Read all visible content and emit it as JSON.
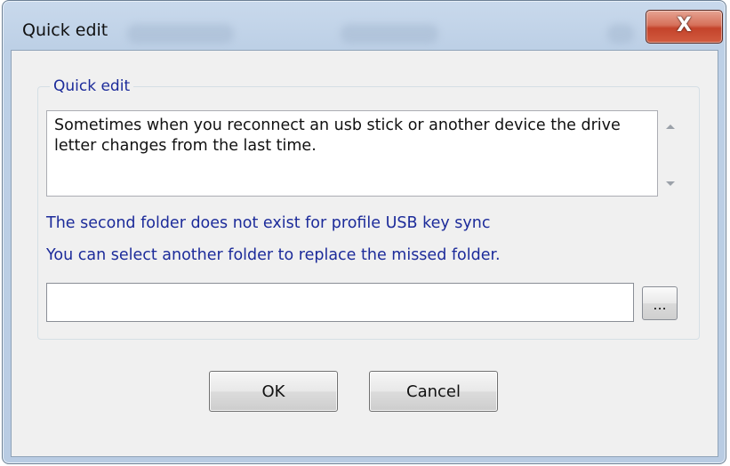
{
  "window": {
    "title": "Quick edit",
    "close_glyph": "X"
  },
  "group": {
    "title": "Quick edit"
  },
  "description": {
    "text": "Sometimes when you reconnect an usb stick or another device the drive letter changes from the last time."
  },
  "messages": {
    "line1": "The second folder does not exist for profile USB key sync",
    "line2": "You can select another folder to replace the missed folder."
  },
  "folder_input": {
    "value": "",
    "placeholder": ""
  },
  "buttons": {
    "browse": "...",
    "ok": "OK",
    "cancel": "Cancel"
  },
  "colors": {
    "label_blue": "#1c2b9a",
    "close_red": "#c4432b",
    "dialog_bg": "#f0f0f0"
  }
}
